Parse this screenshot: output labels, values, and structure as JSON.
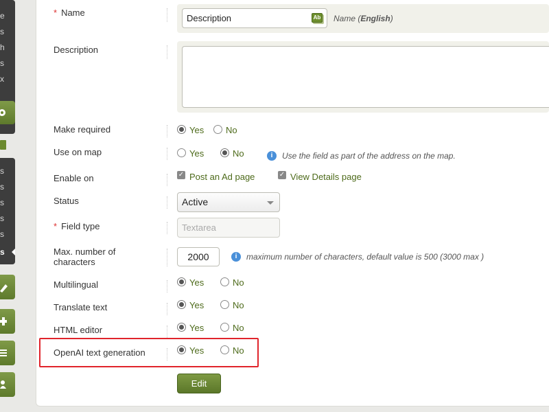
{
  "sidebar": {
    "top_letters": [
      "e",
      "s",
      "h",
      "s",
      "x"
    ],
    "mid_letters": [
      "s",
      "s",
      "s",
      "s",
      "s"
    ],
    "active_letter": "s"
  },
  "fields": {
    "name": {
      "required_mark": "*",
      "label": "Name",
      "value": "Description",
      "ab_icon": "Ab",
      "hint_prefix": "Name (",
      "hint_lang": "English",
      "hint_suffix": ")"
    },
    "description": {
      "label": "Description",
      "value": ""
    },
    "make_required": {
      "label": "Make required",
      "yes": "Yes",
      "no": "No",
      "selected": "Yes"
    },
    "use_on_map": {
      "label": "Use on map",
      "yes": "Yes",
      "no": "No",
      "selected": "No",
      "hint": "Use the field as part of the address on the map."
    },
    "enable_on": {
      "label": "Enable on",
      "option1": "Post an Ad page",
      "option2": "View Details page",
      "option1_checked": true,
      "option2_checked": true
    },
    "status": {
      "label": "Status",
      "value": "Active"
    },
    "field_type": {
      "required_mark": "*",
      "label": "Field type",
      "placeholder": "Textarea"
    },
    "max_chars": {
      "label_line1": "Max. number of",
      "label_line2": "characters",
      "value": "2000",
      "hint": "maximum number of characters, default value is 500 (3000 max )"
    },
    "multilingual": {
      "label": "Multilingual",
      "yes": "Yes",
      "no": "No",
      "selected": "Yes"
    },
    "translate_text": {
      "label": "Translate text",
      "yes": "Yes",
      "no": "No",
      "selected": "Yes"
    },
    "html_editor": {
      "label": "HTML editor",
      "yes": "Yes",
      "no": "No",
      "selected": "Yes"
    },
    "openai": {
      "label": "OpenAI text generation",
      "yes": "Yes",
      "no": "No",
      "selected": "Yes"
    }
  },
  "info_icon": "i",
  "edit_button": "Edit",
  "colors": {
    "accent": "#6b8a2f",
    "highlight": "#e0242b",
    "option_text": "#4d6a1a"
  }
}
